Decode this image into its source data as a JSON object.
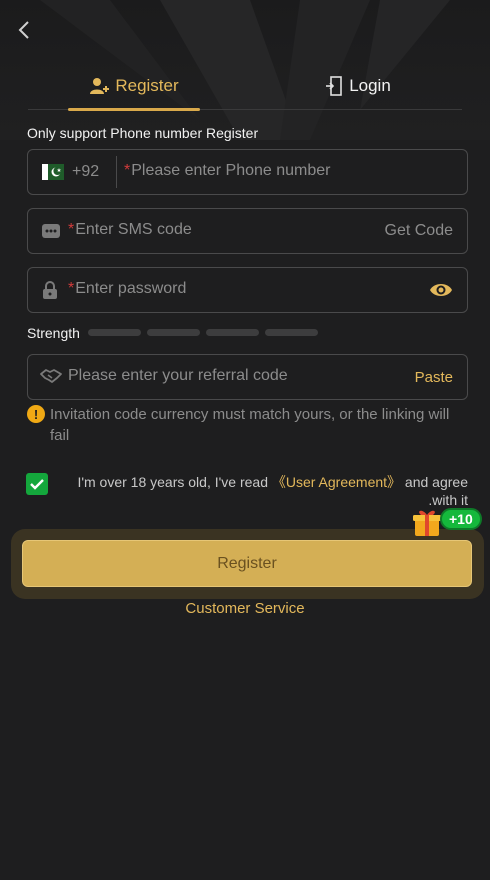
{
  "tabs": {
    "register": "Register",
    "login": "Login"
  },
  "notice": "Only support Phone number Register",
  "phone": {
    "country_code": "+92",
    "required_mark": "*",
    "placeholder": "Please enter Phone number"
  },
  "sms": {
    "required_mark": "*",
    "placeholder": "Enter SMS code",
    "get_code": "Get Code"
  },
  "password": {
    "required_mark": "*",
    "placeholder": "Enter password"
  },
  "strength": {
    "label": "Strength",
    "filled_bars": 0,
    "total_bars": 4
  },
  "referral": {
    "placeholder": "Please enter your referral code",
    "paste": "Paste"
  },
  "warning": "Invitation code currency must match yours, or the linking will fail",
  "agreement": {
    "checked": true,
    "prefix": "I'm over 18 years old, I've read ",
    "link": "《User Agreement》",
    "suffix_1": " and agree",
    "suffix_2": ".with it"
  },
  "bonus_badge": "+10",
  "register_button": "Register",
  "customer_service": "Customer Service",
  "colors": {
    "background": "#1e1e1f",
    "accent_gold": "#e3b85b",
    "button_gold": "#d4af55",
    "check_green": "#14a73c",
    "warn_orange": "#f0a914"
  }
}
